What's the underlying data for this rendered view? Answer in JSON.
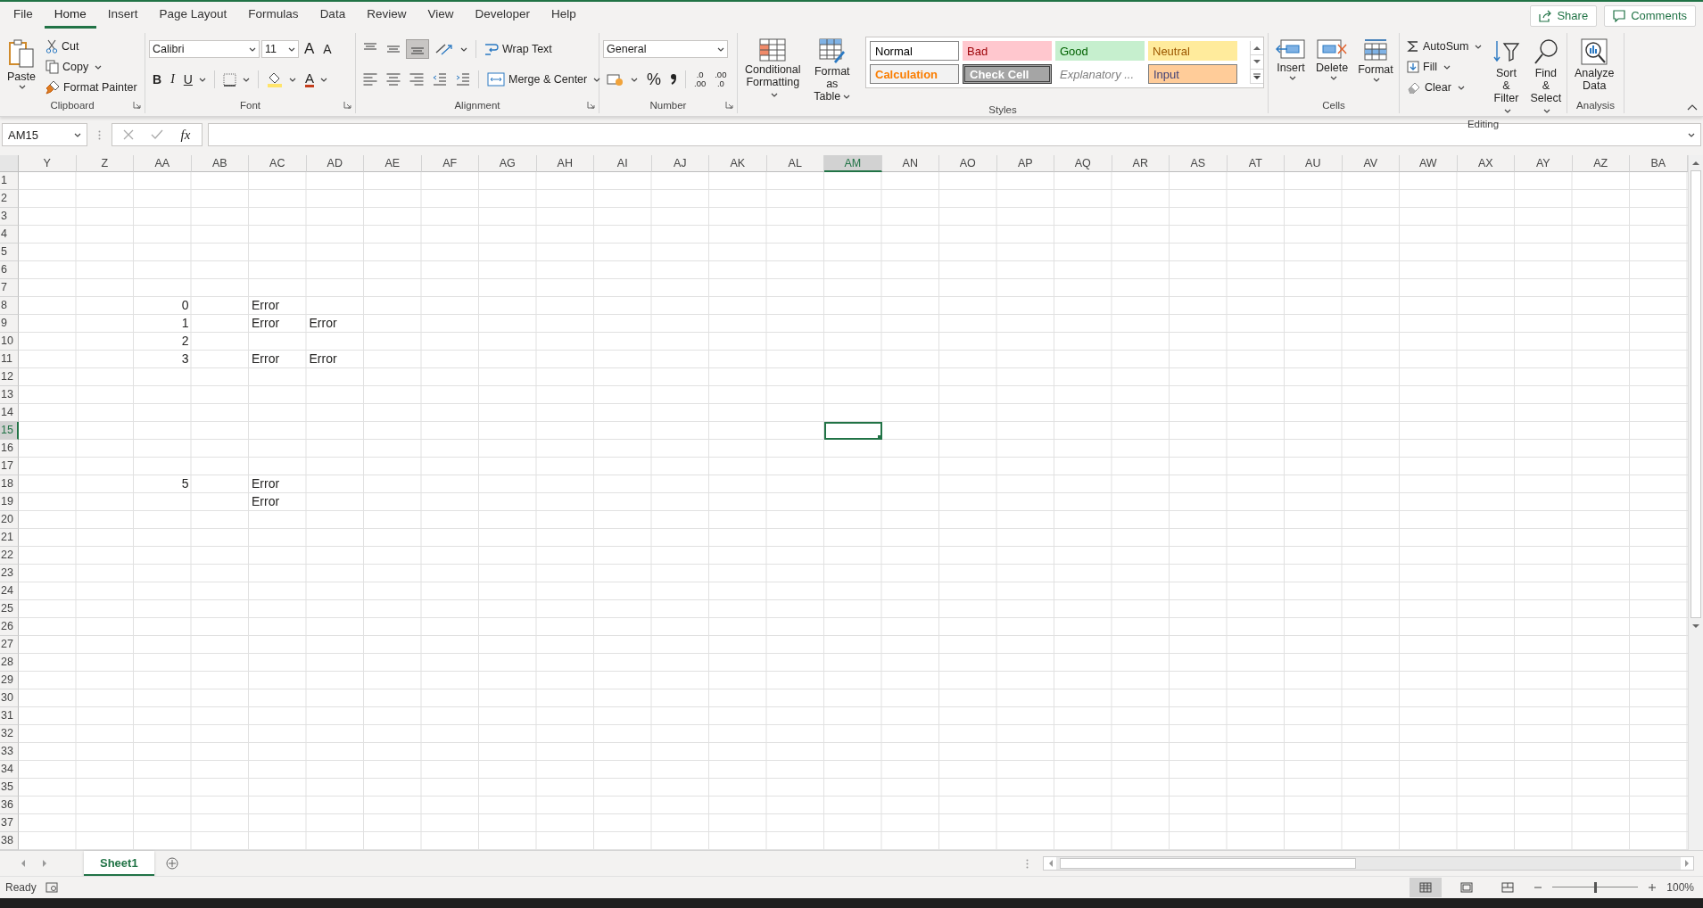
{
  "tabs": [
    {
      "label": "File",
      "selected": false
    },
    {
      "label": "Home",
      "selected": true
    },
    {
      "label": "Insert",
      "selected": false
    },
    {
      "label": "Page Layout",
      "selected": false
    },
    {
      "label": "Formulas",
      "selected": false
    },
    {
      "label": "Data",
      "selected": false
    },
    {
      "label": "Review",
      "selected": false
    },
    {
      "label": "View",
      "selected": false
    },
    {
      "label": "Developer",
      "selected": false
    },
    {
      "label": "Help",
      "selected": false
    }
  ],
  "share": "Share",
  "comments": "Comments",
  "ribbon": [
    {
      "kind": "clipboard",
      "name": "Clipboard",
      "dialog_launcher": true,
      "paste": "Paste",
      "cut": "Cut",
      "copy": "Copy",
      "format_painter": "Format Painter"
    },
    {
      "kind": "font",
      "name": "Font",
      "dialog_launcher": true,
      "font_name": "Calibri",
      "font_size": "11",
      "grow": "A",
      "shrink": "A",
      "bold": "B",
      "italic": "I",
      "underline": "U",
      "font_color": "A"
    },
    {
      "kind": "alignment",
      "name": "Alignment",
      "dialog_launcher": true,
      "vertical": [
        {
          "selected": false
        },
        {
          "selected": false
        },
        {
          "selected": true
        }
      ],
      "horizontal": [
        {
          "selected": false
        },
        {
          "selected": false
        },
        {
          "selected": false
        }
      ],
      "wrap_text": "Wrap Text",
      "merge": "Merge & Center"
    },
    {
      "kind": "number",
      "name": "Number",
      "dialog_launcher": true,
      "format": "General",
      "percent": "%",
      "increase_decimal": {
        "top": ".0",
        "bottom": ".00"
      },
      "decrease_decimal": {
        "top": ".00",
        "bottom": ".0"
      }
    },
    {
      "kind": "styles",
      "name": "Styles",
      "conditional": "Conditional\nFormatting",
      "table": "Format as\nTable",
      "gallery": [
        {
          "label": "Normal",
          "kind": "normal"
        },
        {
          "label": "Bad",
          "kind": "bad"
        },
        {
          "label": "Good",
          "kind": "good"
        },
        {
          "label": "Neutral",
          "kind": "neutral"
        },
        {
          "label": "Calculation",
          "kind": "calculation"
        },
        {
          "label": "Check Cell",
          "kind": "check"
        },
        {
          "label": "Explanatory ...",
          "kind": "explanatory"
        },
        {
          "label": "Input",
          "kind": "input"
        }
      ]
    },
    {
      "kind": "cells",
      "name": "Cells",
      "buttons": [
        {
          "label": "Insert",
          "kind": "insert"
        },
        {
          "label": "Delete",
          "kind": "delete"
        },
        {
          "label": "Format",
          "kind": "format"
        }
      ]
    },
    {
      "kind": "editing",
      "name": "Editing",
      "autosum": "AutoSum",
      "fill": "Fill",
      "clear": "Clear",
      "sort": "Sort &\nFilter",
      "find": "Find &\nSelect"
    },
    {
      "kind": "analysis",
      "name": "Analysis",
      "analyze": "Analyze\nData"
    }
  ],
  "formula_bar": {
    "name_box": "AM15",
    "function_label": "fx"
  },
  "grid": {
    "columns": [
      {
        "label": "Y",
        "selected": false
      },
      {
        "label": "Z",
        "selected": false
      },
      {
        "label": "AA",
        "selected": false
      },
      {
        "label": "AB",
        "selected": false
      },
      {
        "label": "AC",
        "selected": false
      },
      {
        "label": "AD",
        "selected": false
      },
      {
        "label": "AE",
        "selected": false
      },
      {
        "label": "AF",
        "selected": false
      },
      {
        "label": "AG",
        "selected": false
      },
      {
        "label": "AH",
        "selected": false
      },
      {
        "label": "AI",
        "selected": false
      },
      {
        "label": "AJ",
        "selected": false
      },
      {
        "label": "AK",
        "selected": false
      },
      {
        "label": "AL",
        "selected": false
      },
      {
        "label": "AM",
        "selected": true
      },
      {
        "label": "AN",
        "selected": false
      },
      {
        "label": "AO",
        "selected": false
      },
      {
        "label": "AP",
        "selected": false
      },
      {
        "label": "AQ",
        "selected": false
      },
      {
        "label": "AR",
        "selected": false
      },
      {
        "label": "AS",
        "selected": false
      },
      {
        "label": "AT",
        "selected": false
      },
      {
        "label": "AU",
        "selected": false
      },
      {
        "label": "AV",
        "selected": false
      },
      {
        "label": "AW",
        "selected": false
      },
      {
        "label": "AX",
        "selected": false
      },
      {
        "label": "AY",
        "selected": false
      },
      {
        "label": "AZ",
        "selected": false
      },
      {
        "label": "BA",
        "selected": false
      }
    ],
    "rows": [
      {
        "label": "1",
        "selected": false
      },
      {
        "label": "2",
        "selected": false
      },
      {
        "label": "3",
        "selected": false
      },
      {
        "label": "4",
        "selected": false
      },
      {
        "label": "5",
        "selected": false
      },
      {
        "label": "6",
        "selected": false
      },
      {
        "label": "7",
        "selected": false
      },
      {
        "label": "8",
        "selected": false,
        "cells": [
          {},
          {},
          {
            "text": "0",
            "kind": "number"
          },
          {},
          {
            "text": "Error",
            "kind": "text"
          }
        ]
      },
      {
        "label": "9",
        "selected": false,
        "cells": [
          {},
          {},
          {
            "text": "1",
            "kind": "number"
          },
          {},
          {
            "text": "Error",
            "kind": "text"
          },
          {
            "text": "Error",
            "kind": "text"
          }
        ]
      },
      {
        "label": "10",
        "selected": false,
        "cells": [
          {},
          {},
          {
            "text": "2",
            "kind": "number"
          }
        ]
      },
      {
        "label": "11",
        "selected": false,
        "cells": [
          {},
          {},
          {
            "text": "3",
            "kind": "number"
          },
          {},
          {
            "text": "Error",
            "kind": "text"
          },
          {
            "text": "Error",
            "kind": "text"
          }
        ]
      },
      {
        "label": "12",
        "selected": false
      },
      {
        "label": "13",
        "selected": false
      },
      {
        "label": "14",
        "selected": false
      },
      {
        "label": "15",
        "selected": true
      },
      {
        "label": "16",
        "selected": false
      },
      {
        "label": "17",
        "selected": false
      },
      {
        "label": "18",
        "selected": false,
        "cells": [
          {},
          {},
          {
            "text": "5",
            "kind": "number"
          },
          {},
          {
            "text": "Error",
            "kind": "text"
          }
        ]
      },
      {
        "label": "19",
        "selected": false,
        "cells": [
          {},
          {},
          {},
          {},
          {
            "text": "Error",
            "kind": "text"
          }
        ]
      },
      {
        "label": "20",
        "selected": false
      },
      {
        "label": "21",
        "selected": false
      },
      {
        "label": "22",
        "selected": false
      },
      {
        "label": "23",
        "selected": false
      },
      {
        "label": "24",
        "selected": false
      },
      {
        "label": "25",
        "selected": false
      },
      {
        "label": "26",
        "selected": false
      },
      {
        "label": "27",
        "selected": false
      },
      {
        "label": "28",
        "selected": false
      },
      {
        "label": "29",
        "selected": false
      },
      {
        "label": "30",
        "selected": false
      },
      {
        "label": "31",
        "selected": false
      },
      {
        "label": "32",
        "selected": false
      },
      {
        "label": "33",
        "selected": false
      },
      {
        "label": "34",
        "selected": false
      },
      {
        "label": "35",
        "selected": false
      },
      {
        "label": "36",
        "selected": false
      },
      {
        "label": "37",
        "selected": false
      },
      {
        "label": "38",
        "selected": false
      }
    ]
  },
  "sheets": [
    {
      "label": "Sheet1",
      "selected": true
    }
  ],
  "status": {
    "text": "Ready",
    "views": [
      {
        "kind": "normal",
        "selected": true
      },
      {
        "kind": "page-layout",
        "selected": false
      },
      {
        "kind": "page-break",
        "selected": false
      }
    ],
    "zoom": {
      "level": 0.5,
      "reading": "100%"
    }
  }
}
